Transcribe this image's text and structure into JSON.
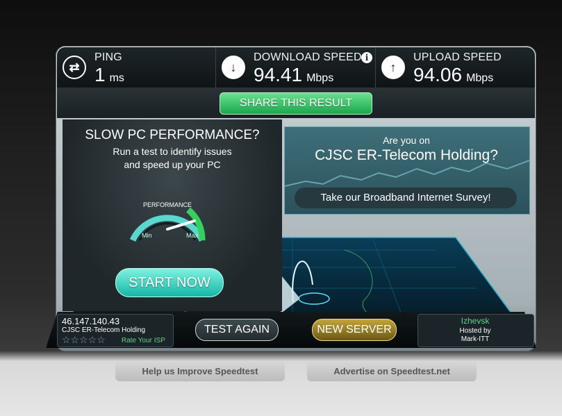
{
  "stats": {
    "ping": {
      "label": "PING",
      "value": "1",
      "unit": "ms"
    },
    "download": {
      "label": "DOWNLOAD SPEED",
      "value": "94.41",
      "unit": "Mbps"
    },
    "upload": {
      "label": "UPLOAD SPEED",
      "value": "94.06",
      "unit": "Mbps"
    }
  },
  "icons": {
    "ping": "exchange-arrows-icon",
    "download": "download-arrow-icon",
    "upload": "upload-arrow-icon",
    "info": "info-icon",
    "rating": "star-icon"
  },
  "share": {
    "label": "SHARE THIS RESULT"
  },
  "promo_left": {
    "title": "SLOW PC PERFORMANCE?",
    "line1": "Run a test to identify issues",
    "line2": "and speed up your PC",
    "gauge": {
      "label": "PERFORMANCE",
      "min": "Min",
      "max": "Max"
    },
    "button": "START NOW"
  },
  "promo_right": {
    "question": "Are you on",
    "isp": "CJSC ER-Telecom Holding?",
    "survey": "Take our Broadband Internet Survey!"
  },
  "client": {
    "ip": "46.147.140.43",
    "isp": "CJSC ER-Telecom Holding",
    "stars": "☆☆☆☆☆",
    "rate_label": "Rate Your ISP"
  },
  "actions": {
    "test_again": "TEST AGAIN",
    "new_server": "NEW SERVER"
  },
  "server": {
    "city": "Izhevsk",
    "hosted_by": "Hosted by",
    "host": "Mark-ITT"
  },
  "footer": {
    "help": "Help us Improve Speedtest",
    "advertise": "Advertise on Speedtest.net"
  },
  "colors": {
    "share_green": "#19a84a",
    "start_teal": "#16b6a7",
    "server_gold": "#c2a53a",
    "map_blue": "#1fb0d6"
  }
}
